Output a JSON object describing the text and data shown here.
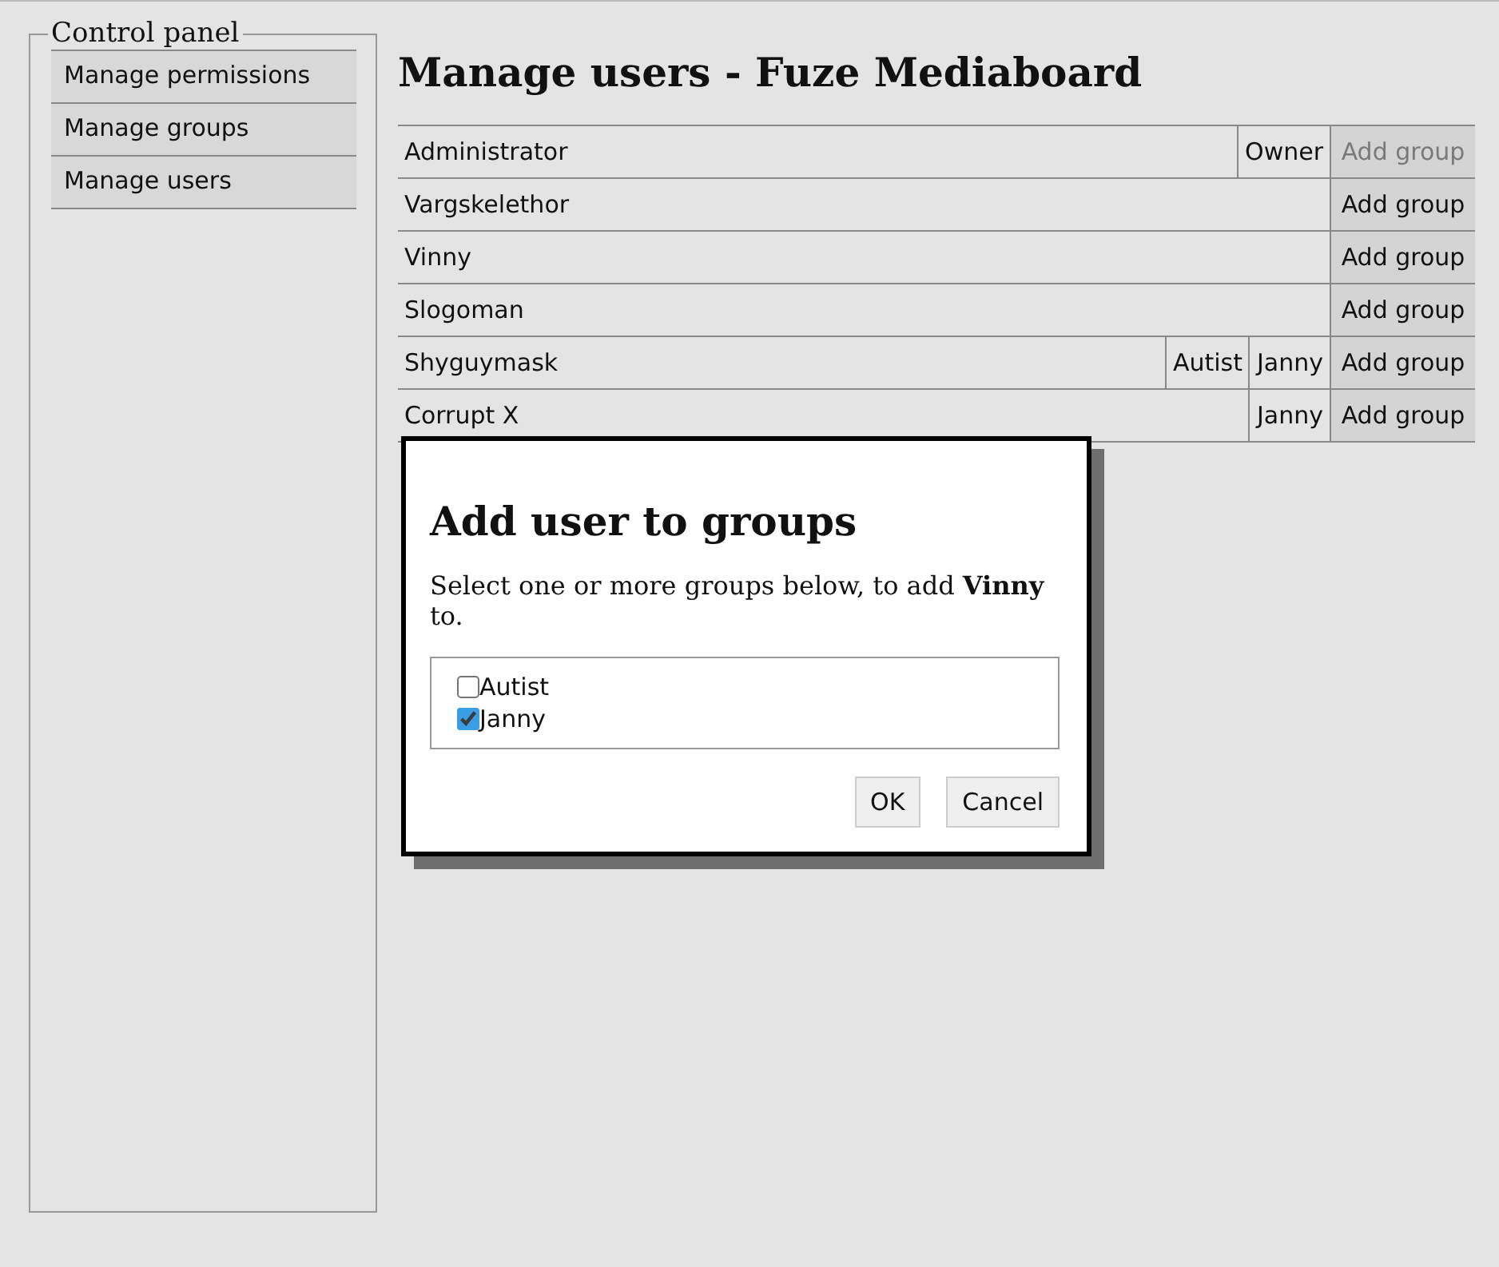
{
  "sidebar": {
    "title": "Control panel",
    "items": [
      {
        "label": "Manage permissions"
      },
      {
        "label": "Manage groups"
      },
      {
        "label": "Manage users"
      }
    ]
  },
  "page_title": "Manage users - Fuze Mediaboard",
  "users": [
    {
      "name": "Administrator",
      "groups": [
        "Owner"
      ],
      "add_button": {
        "label": "Add group",
        "disabled": true
      }
    },
    {
      "name": "Vargskelethor",
      "add_button": {
        "label": "Add group",
        "disabled": false
      }
    },
    {
      "name": "Vinny",
      "add_button": {
        "label": "Add group",
        "disabled": false
      }
    },
    {
      "name": "Slogoman",
      "add_button": {
        "label": "Add group",
        "disabled": false
      }
    },
    {
      "name": "Shyguymask",
      "groups": [
        "Autist",
        "Janny"
      ],
      "add_button": {
        "label": "Add group",
        "disabled": false
      }
    },
    {
      "name": "Corrupt X",
      "groups": [
        "Janny"
      ],
      "add_button": {
        "label": "Add group",
        "disabled": false
      }
    }
  ],
  "dialog": {
    "title": "Add user to groups",
    "message": "Select one or more groups below, to add **Vinny** to.",
    "options": [
      {
        "label": "Autist",
        "checked": false
      },
      {
        "label": "Janny",
        "checked": true
      }
    ],
    "buttons": [
      "OK",
      "Cancel"
    ]
  }
}
